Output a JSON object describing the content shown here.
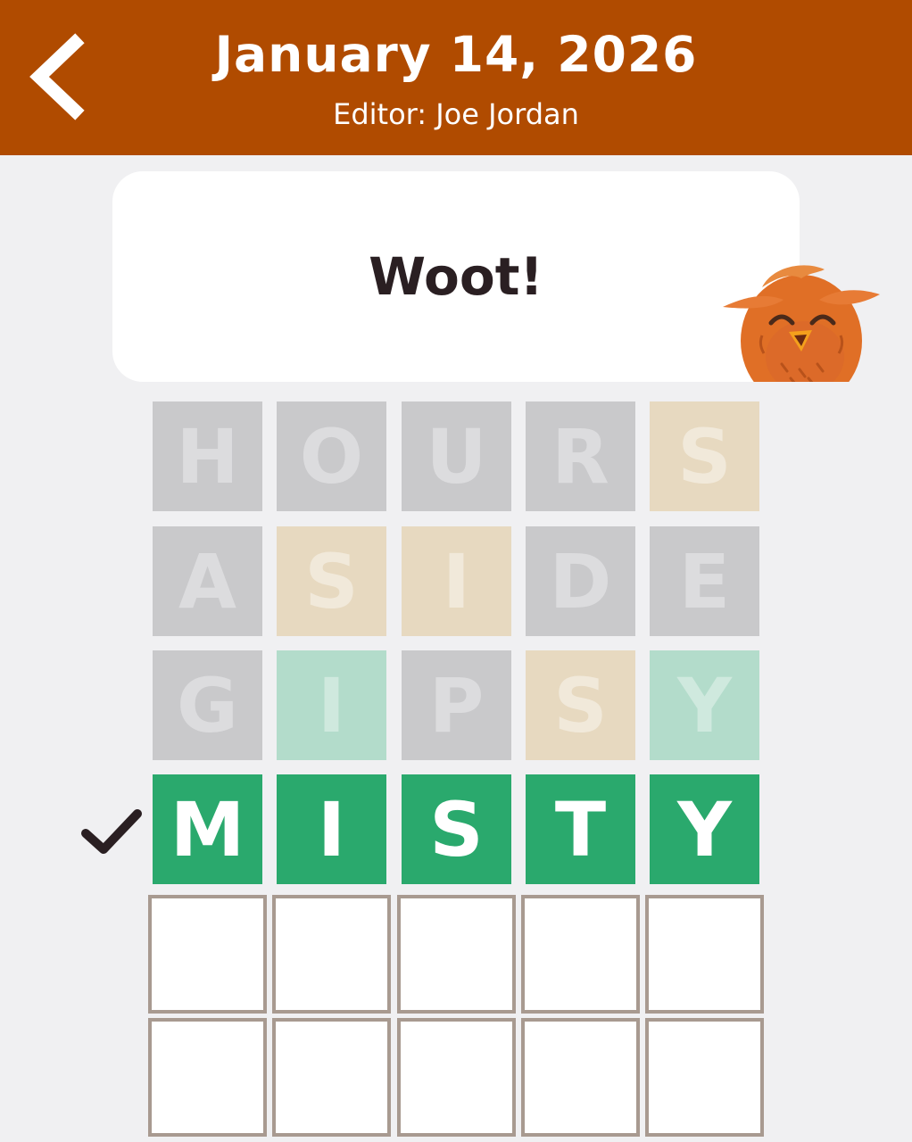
{
  "header": {
    "title": "January 14, 2026",
    "subtitle": "Editor: Joe Jordan",
    "back_icon": "chevron-left-icon"
  },
  "message": {
    "text": "Woot!",
    "mascot": "owl-mascot"
  },
  "board": {
    "rows": [
      {
        "letters": [
          "H",
          "O",
          "U",
          "R",
          "S"
        ],
        "states": [
          "absent",
          "absent",
          "absent",
          "absent",
          "present"
        ],
        "faded": true
      },
      {
        "letters": [
          "A",
          "S",
          "I",
          "D",
          "E"
        ],
        "states": [
          "absent",
          "present",
          "present",
          "absent",
          "absent"
        ],
        "faded": true
      },
      {
        "letters": [
          "G",
          "I",
          "P",
          "S",
          "Y"
        ],
        "states": [
          "absent",
          "correct",
          "absent",
          "present",
          "correct"
        ],
        "faded": true
      },
      {
        "letters": [
          "M",
          "I",
          "S",
          "T",
          "Y"
        ],
        "states": [
          "correct",
          "correct",
          "correct",
          "correct",
          "correct"
        ],
        "faded": false
      },
      {
        "letters": [
          "",
          "",
          "",
          "",
          ""
        ],
        "states": [
          "empty",
          "empty",
          "empty",
          "empty",
          "empty"
        ],
        "faded": false
      },
      {
        "letters": [
          "",
          "",
          "",
          "",
          ""
        ],
        "states": [
          "empty",
          "empty",
          "empty",
          "empty",
          "empty"
        ],
        "faded": false
      }
    ],
    "solved_row_icon": "checkmark-icon",
    "colors": {
      "correct": "#2aa96d",
      "header": "#b04b00"
    }
  }
}
